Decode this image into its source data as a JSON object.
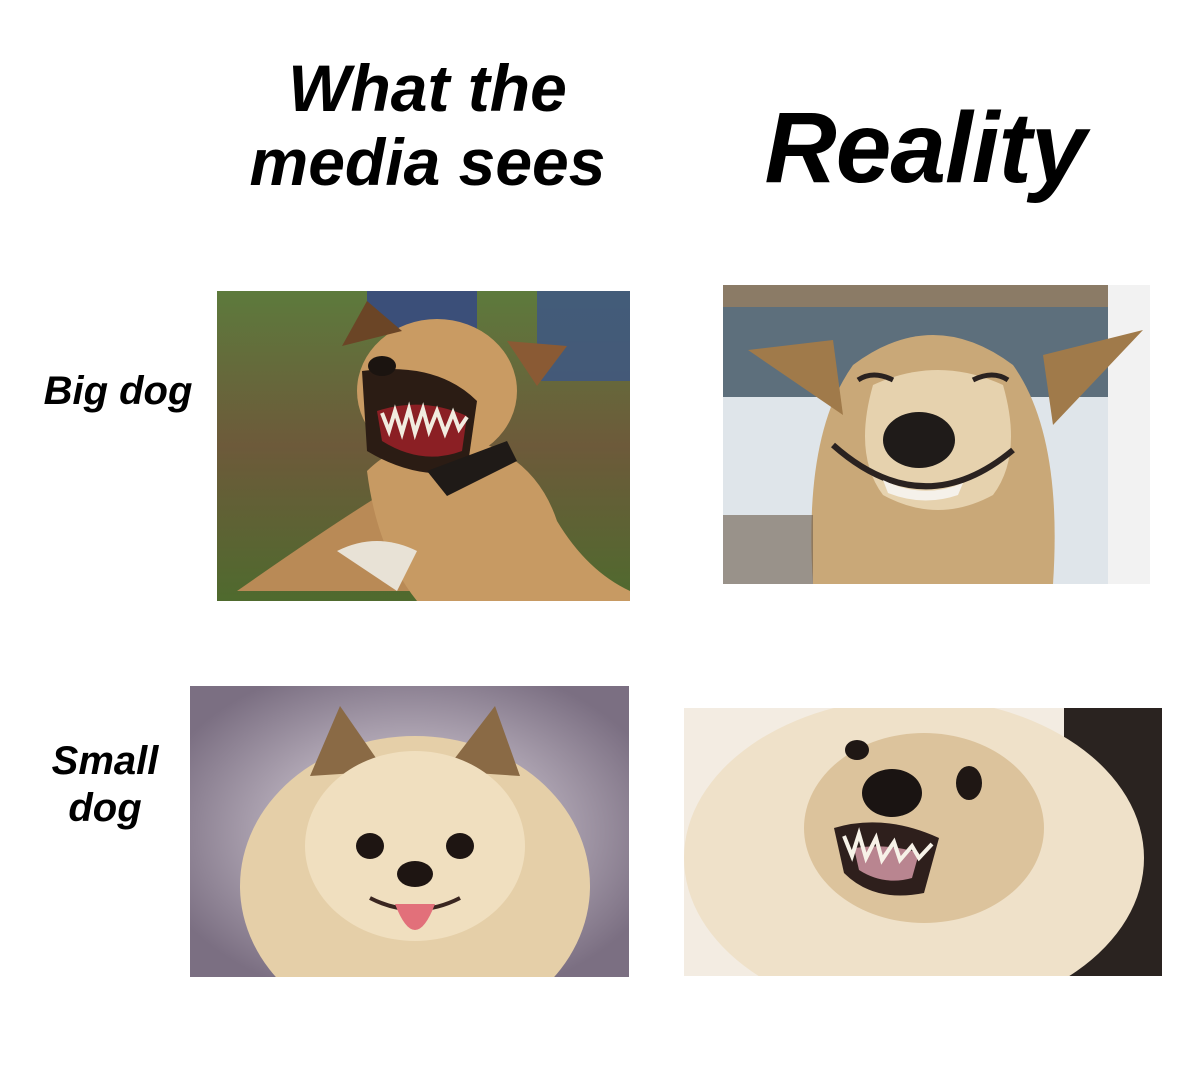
{
  "header": {
    "left_title": "What the media sees",
    "right_title": "Reality"
  },
  "rows": [
    {
      "label": "Big dog"
    },
    {
      "label": "Small dog"
    }
  ],
  "photos": [
    {
      "row": "Big dog",
      "column": "What the media sees",
      "subject": "snarling brown boxer-type dog with bared teeth on grass"
    },
    {
      "row": "Big dog",
      "column": "Reality",
      "subject": "smiling tan husky-type dog by icy water"
    },
    {
      "row": "Small dog",
      "column": "What the media sees",
      "subject": "fluffy cream pomeranian with tongue out"
    },
    {
      "row": "Small dog",
      "column": "Reality",
      "subject": "fluffy pomeranian baring teeth"
    }
  ]
}
